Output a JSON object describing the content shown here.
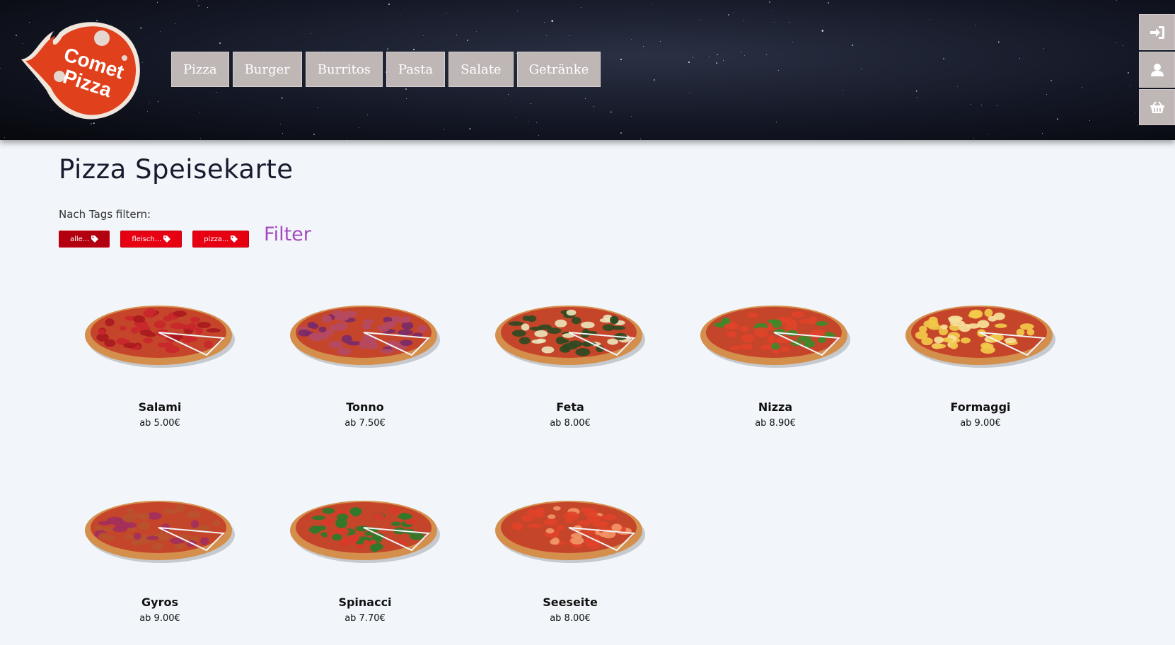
{
  "header": {
    "logo_text_line1": "Comet",
    "logo_text_line2": "Pizza",
    "nav": [
      "Pizza",
      "Burger",
      "Burritos",
      "Pasta",
      "Salate",
      "Getränke"
    ],
    "side_buttons": [
      "login-icon",
      "user-icon",
      "basket-icon"
    ]
  },
  "main": {
    "title": "Pizza Speisekarte",
    "filter_label": "Nach Tags filtern:",
    "tags": [
      "alle...",
      "fleisch...",
      "pizza..."
    ],
    "filter_link": "Filter"
  },
  "products": [
    {
      "name": "Salami",
      "price": "ab 5.00€",
      "topping": "#c8272b",
      "accent": "#a81a1e"
    },
    {
      "name": "Tonno",
      "price": "ab 7.50€",
      "topping": "#b54a63",
      "accent": "#7a2a6a"
    },
    {
      "name": "Feta",
      "price": "ab 8.00€",
      "topping": "#2f4a22",
      "accent": "#ece2b8"
    },
    {
      "name": "Nizza",
      "price": "ab 8.90€",
      "topping": "#e0432a",
      "accent": "#3c8a2a"
    },
    {
      "name": "Formaggi",
      "price": "ab 9.00€",
      "topping": "#f2c94a",
      "accent": "#f6e19a"
    },
    {
      "name": "Gyros",
      "price": "ab 9.00€",
      "topping": "#b9532e",
      "accent": "#a32f5b"
    },
    {
      "name": "Spinacci",
      "price": "ab 7.70€",
      "topping": "#2f7a2a",
      "accent": "#d93a2a"
    },
    {
      "name": "Seeseite",
      "price": "ab 8.00€",
      "topping": "#e0432a",
      "accent": "#f19466"
    }
  ],
  "colors": {
    "nav_bg": "#bfb6b6",
    "tag_red": "#e60012",
    "filter_purple": "#a44ac0",
    "logo_orange": "#e0401b"
  }
}
